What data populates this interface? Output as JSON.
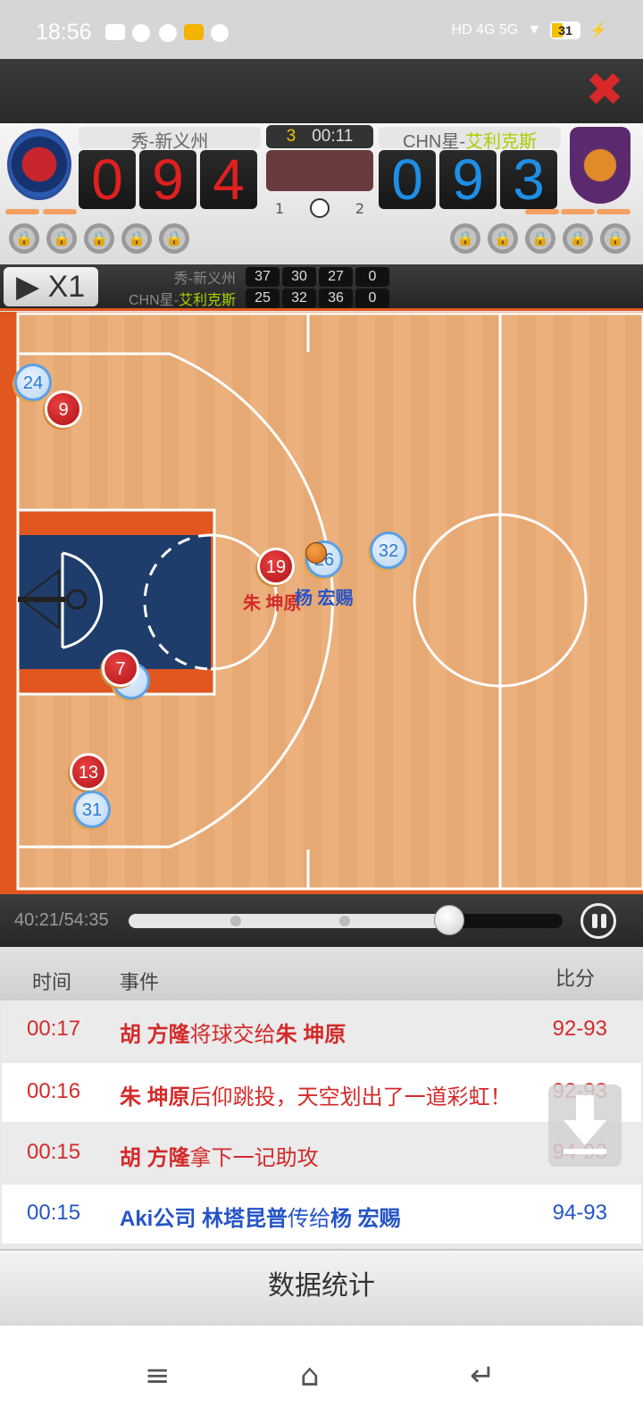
{
  "status_bar": {
    "time": "18:56",
    "network": "HD 4G 5G",
    "battery": "31"
  },
  "header": {
    "close_icon": "close-icon"
  },
  "scoreboard": {
    "home": {
      "name_prefix": "秀-",
      "name_main": "新义州",
      "score_digits": [
        "0",
        "9",
        "4"
      ],
      "logo_icon": "eagle-logo"
    },
    "away": {
      "name_prefix": "CHN星-",
      "name_main": "艾利克斯",
      "score_digits": [
        "0",
        "9",
        "3"
      ],
      "logo_icon": "tiger-logo"
    },
    "quarter": "3",
    "clock": "00:11",
    "half_1": "1",
    "half_2": "2",
    "colors": {
      "home": "#e0201f",
      "away": "#1e8fe6",
      "accent": "#e1571f"
    }
  },
  "controls": {
    "speed_label": "X1",
    "quarter_scores": {
      "home_label_prefix": "秀-",
      "home_label_main": "新义州",
      "home": [
        "37",
        "30",
        "27",
        "0"
      ],
      "away_label_prefix": "CHN星-",
      "away_label_main": "艾利克斯",
      "away": [
        "25",
        "32",
        "36",
        "0"
      ]
    }
  },
  "court": {
    "players": [
      {
        "number": "24",
        "team": "away"
      },
      {
        "number": "9",
        "team": "home"
      },
      {
        "number": "19",
        "team": "home"
      },
      {
        "number": "26",
        "team": "away"
      },
      {
        "number": "32",
        "team": "away"
      },
      {
        "number": "7",
        "team": "home"
      },
      {
        "number": "13",
        "team": "home"
      },
      {
        "number": "31",
        "team": "away"
      }
    ],
    "label_home": "朱 坤原",
    "label_away": "杨 宏赐"
  },
  "playback": {
    "time": "40:21/54:35",
    "progress": 0.74
  },
  "events": {
    "headers": {
      "time": "时间",
      "event": "事件",
      "score": "比分"
    },
    "rows": [
      {
        "time": "00:17",
        "p1": "胡 方隆",
        "action": "将球交给",
        "p2": "朱 坤原",
        "score": "92-93",
        "team": "home"
      },
      {
        "time": "00:16",
        "p1": "朱 坤原",
        "action": "后仰跳投，天空划出了一道彩虹！",
        "p2": "",
        "score": "92-93",
        "team": "home"
      },
      {
        "time": "00:15",
        "p1": "胡 方隆",
        "action": "拿下一记助攻",
        "p2": "",
        "score": "94-93",
        "team": "home"
      },
      {
        "time": "00:15",
        "p1": "Aki公司 林塔昆普",
        "action": "传给",
        "p2": "杨 宏赐",
        "score": "94-93",
        "team": "away"
      }
    ]
  },
  "stats_button": "数据统计"
}
